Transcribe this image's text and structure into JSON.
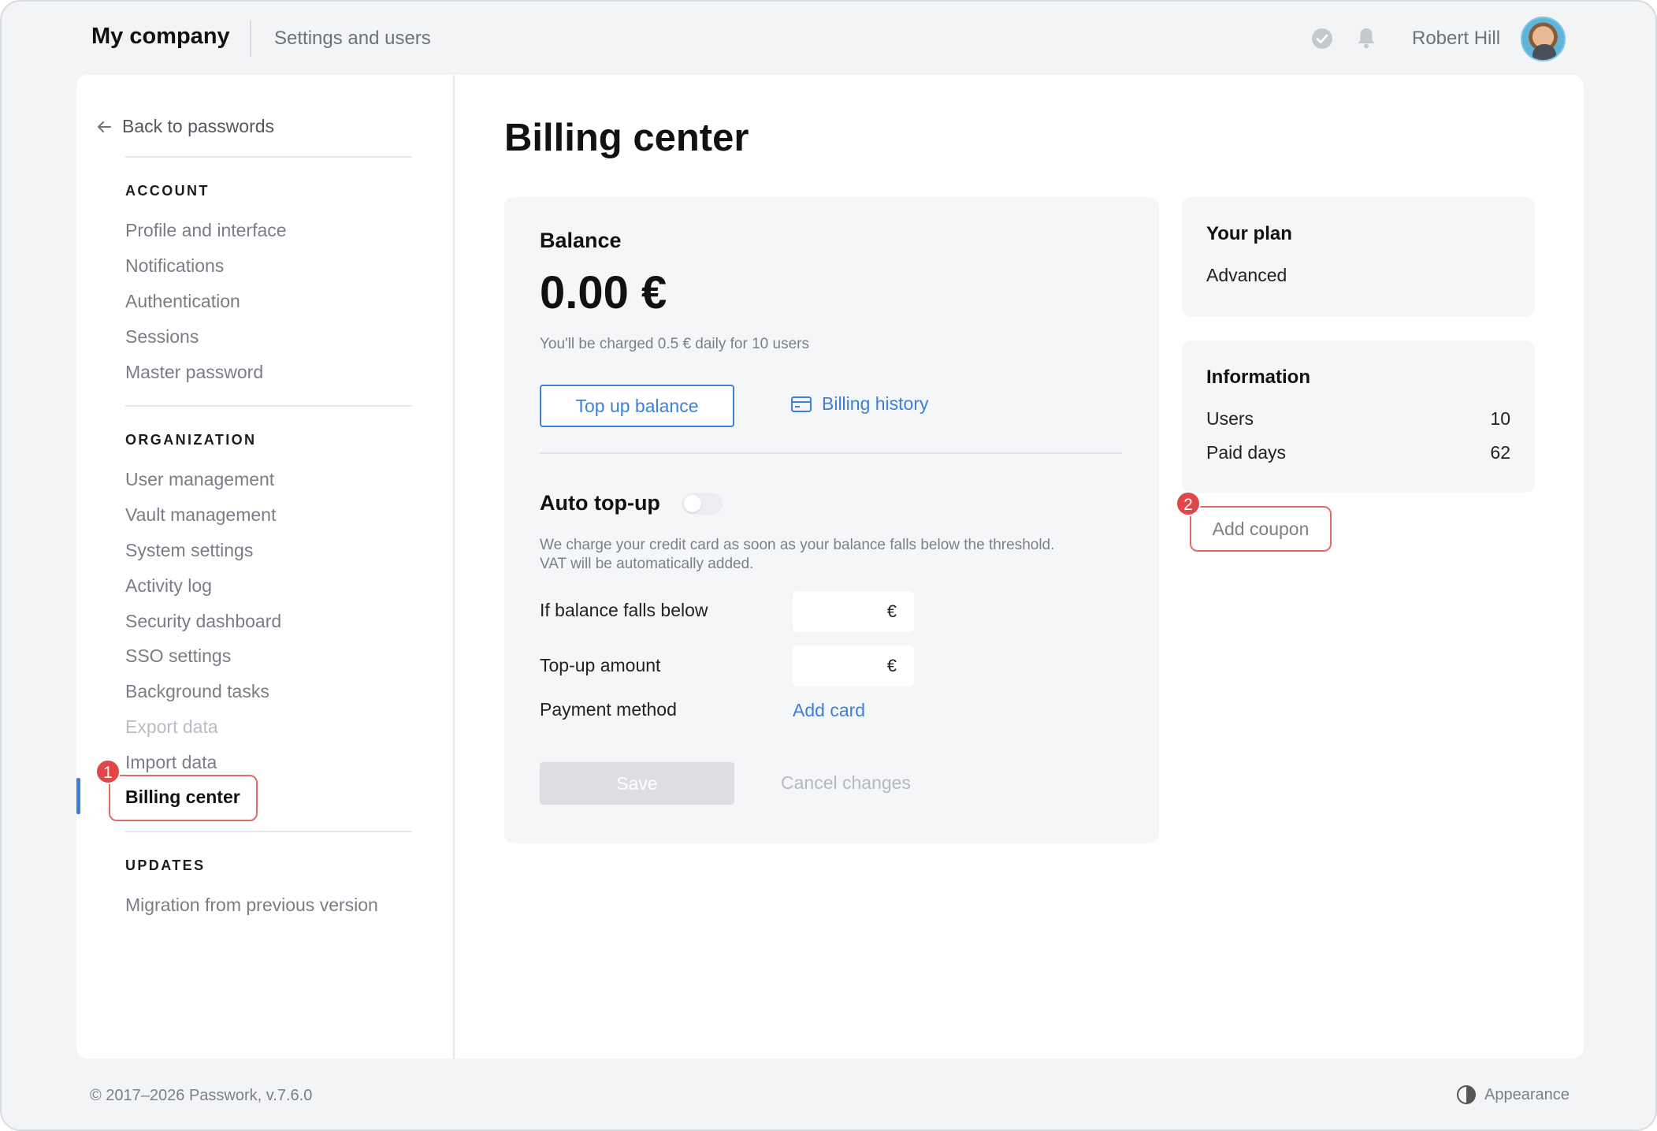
{
  "header": {
    "company": "My company",
    "section": "Settings and users",
    "user_name": "Robert Hill"
  },
  "sidebar": {
    "back_label": "Back to passwords",
    "groups": [
      {
        "title": "ACCOUNT",
        "items": [
          "Profile and interface",
          "Notifications",
          "Authentication",
          "Sessions",
          "Master password"
        ]
      },
      {
        "title": "ORGANIZATION",
        "items": [
          "User management",
          "Vault management",
          "System settings",
          "Activity log",
          "Security dashboard",
          "SSO settings",
          "Background tasks",
          "Export data",
          "Import data",
          "Billing center"
        ]
      },
      {
        "title": "UPDATES",
        "items": [
          "Migration from previous version"
        ]
      }
    ],
    "badge_1": "1"
  },
  "main": {
    "page_title": "Billing center",
    "balance": {
      "title": "Balance",
      "amount": "0.00 €",
      "note": "You'll be charged 0.5 € daily for 10 users",
      "top_up_label": "Top up balance",
      "history_label": "Billing history"
    },
    "auto_topup": {
      "title": "Auto top-up",
      "enabled": false,
      "description_line1": "We charge your credit card as soon as your balance falls below the threshold.",
      "description_line2": "VAT will be automatically added.",
      "threshold_label": "If balance falls below",
      "threshold_unit": "€",
      "amount_label": "Top-up amount",
      "amount_unit": "€",
      "payment_label": "Payment method",
      "add_card_label": "Add card",
      "save_label": "Save",
      "cancel_label": "Cancel changes"
    },
    "plan": {
      "title": "Your plan",
      "name": "Advanced"
    },
    "information": {
      "title": "Information",
      "rows": [
        {
          "label": "Users",
          "value": "10"
        },
        {
          "label": "Paid days",
          "value": "62"
        }
      ]
    },
    "coupon_label": "Add coupon",
    "badge_2": "2"
  },
  "footer": {
    "copyright": "© 2017–2026 Passwork, v.7.6.0",
    "appearance_label": "Appearance"
  },
  "colors": {
    "accent": "#3d7fd9",
    "highlight": "#e26a6a",
    "badge": "#e04848"
  }
}
